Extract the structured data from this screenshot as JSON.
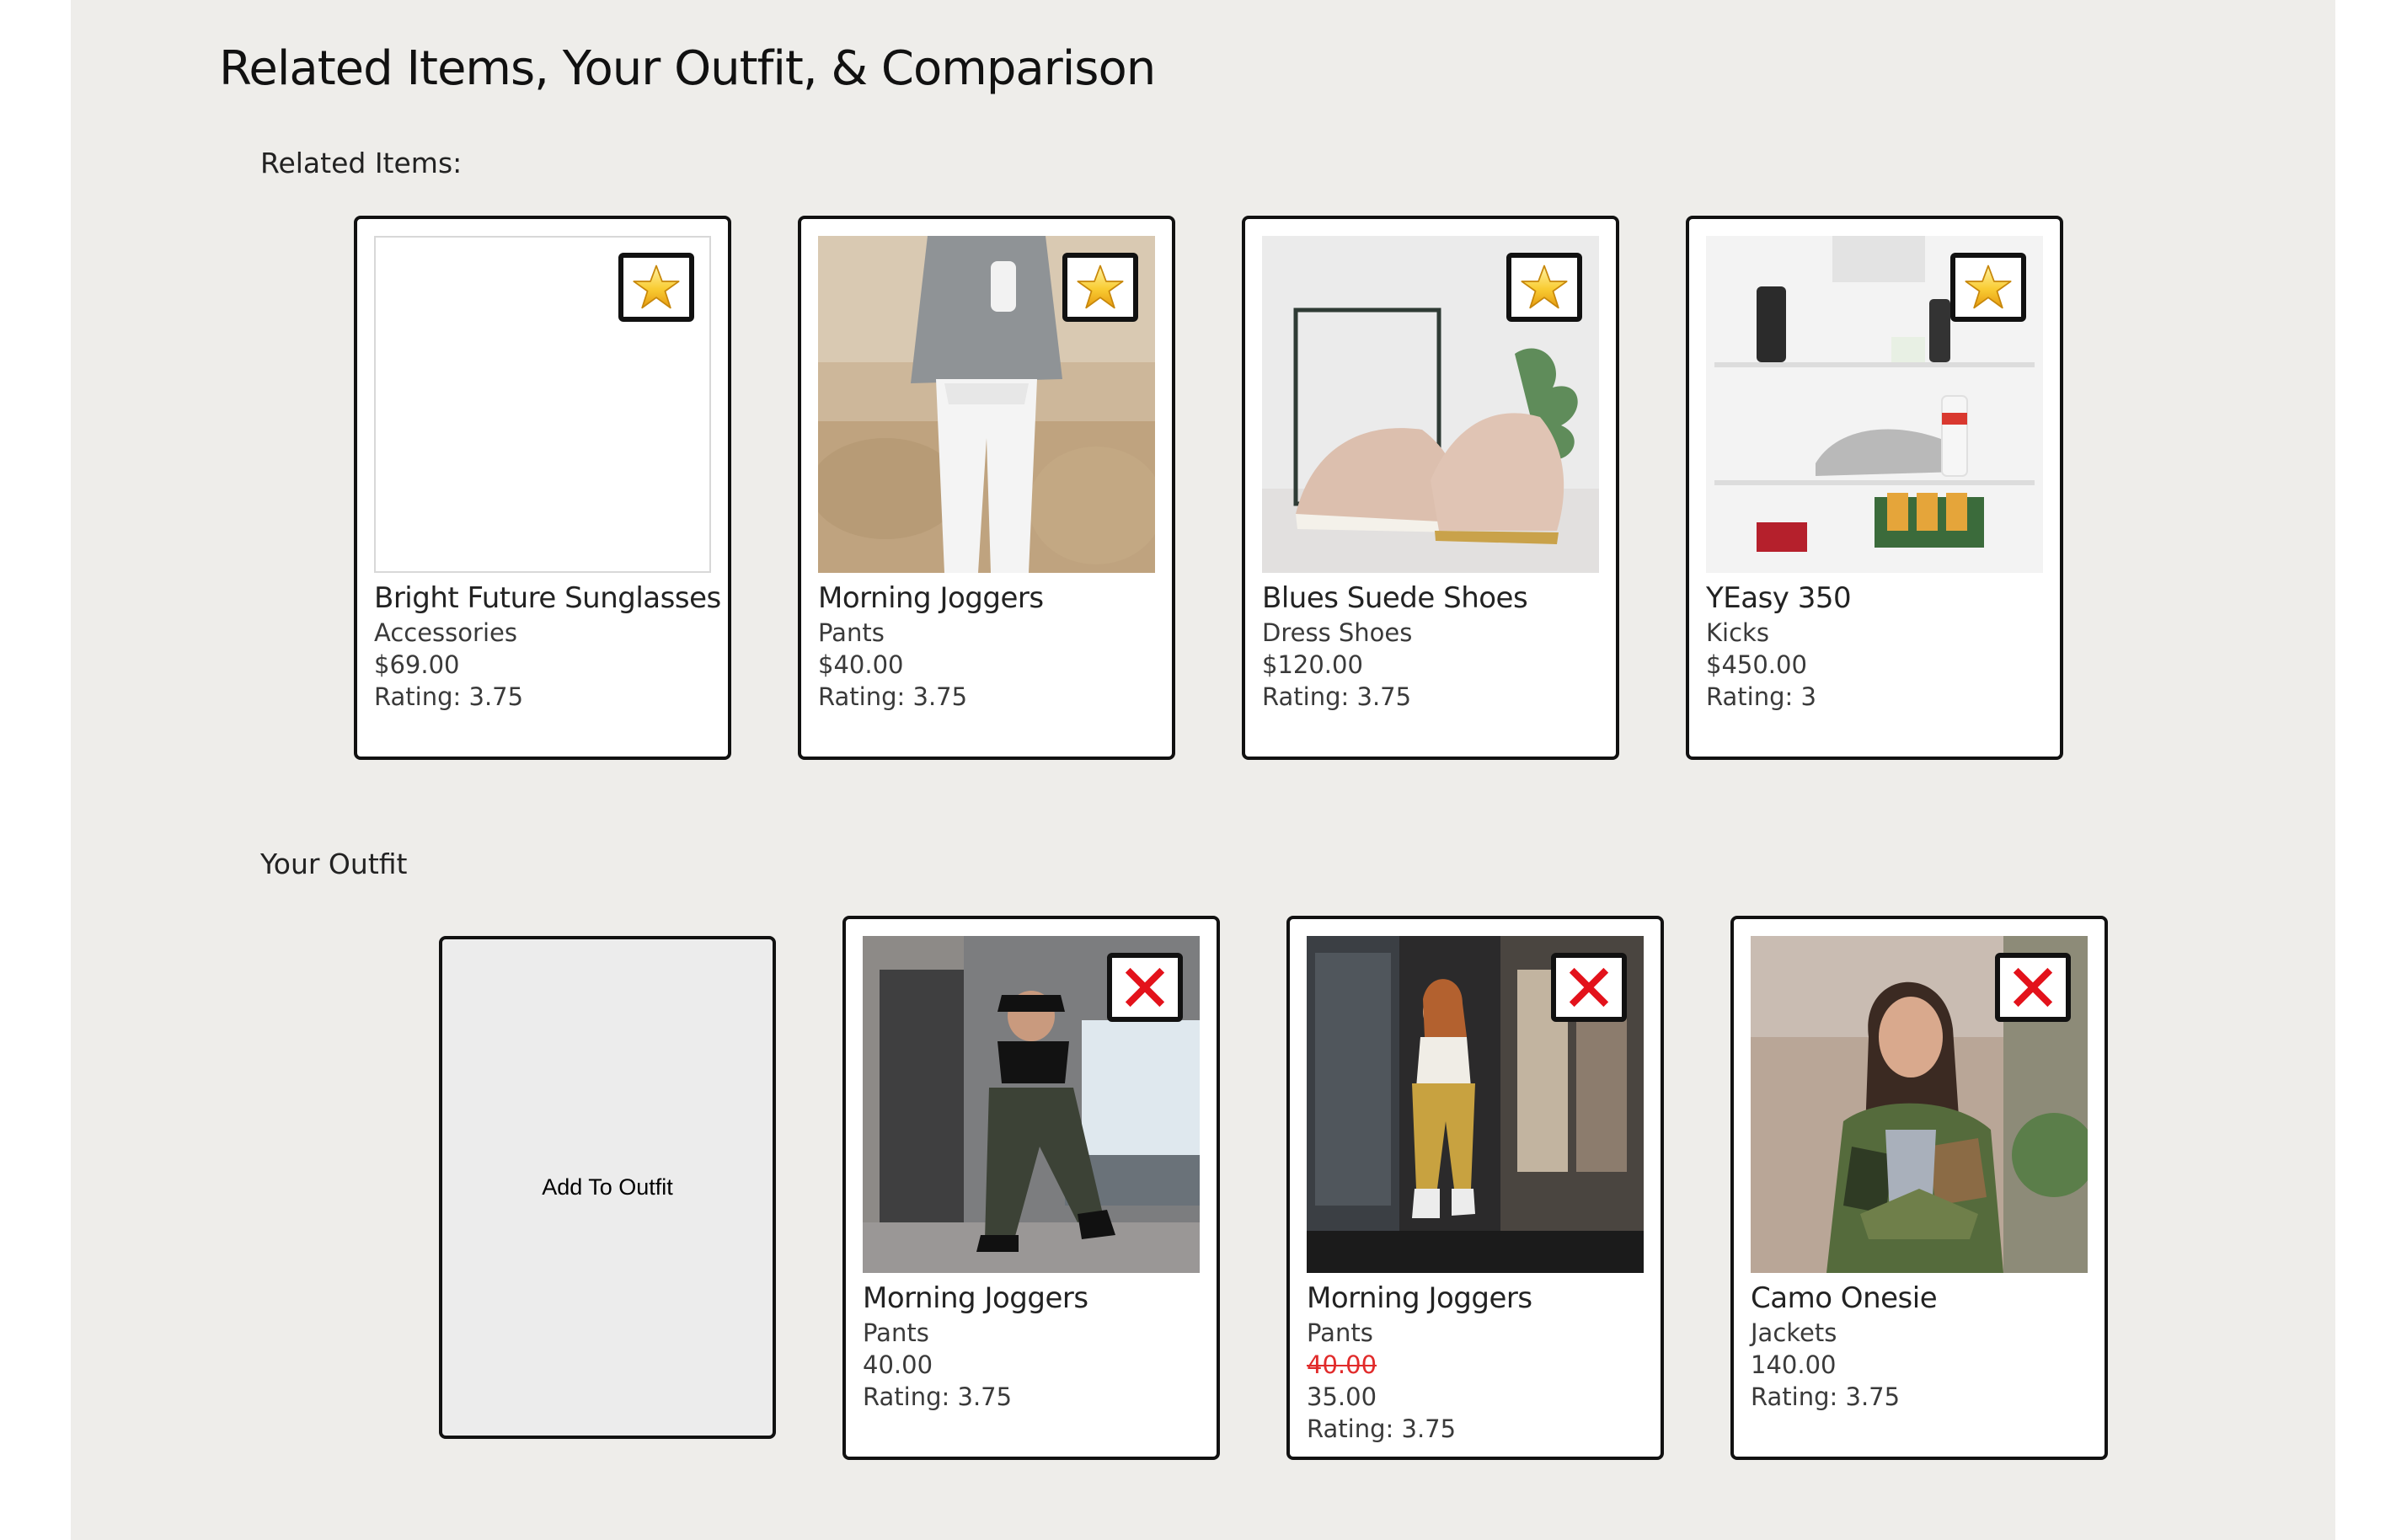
{
  "page": {
    "title": "Related Items, Your Outfit, & Comparison"
  },
  "related": {
    "label": "Related Items:",
    "items": [
      {
        "name": "Bright Future Sunglasses",
        "category": "Accessories",
        "price": "$69.00",
        "rating": "Rating: 3.75",
        "icon": "star-icon"
      },
      {
        "name": "Morning Joggers",
        "category": "Pants",
        "price": "$40.00",
        "rating": "Rating: 3.75",
        "icon": "star-icon"
      },
      {
        "name": "Blues Suede Shoes",
        "category": "Dress Shoes",
        "price": "$120.00",
        "rating": "Rating: 3.75",
        "icon": "star-icon"
      },
      {
        "name": "YEasy 350",
        "category": "Kicks",
        "price": "$450.00",
        "rating": "Rating: 3",
        "icon": "star-icon"
      }
    ]
  },
  "outfit": {
    "label": "Your Outfit",
    "add_label": "Add To Outfit",
    "items": [
      {
        "name": "Morning Joggers",
        "category": "Pants",
        "price": "40.00",
        "rating": "Rating: 3.75",
        "icon": "close-icon"
      },
      {
        "name": "Morning Joggers",
        "category": "Pants",
        "original_price": "40.00",
        "sale_price": "35.00",
        "rating": "Rating: 3.75",
        "icon": "close-icon"
      },
      {
        "name": "Camo Onesie",
        "category": "Jackets",
        "price": "140.00",
        "rating": "Rating: 3.75",
        "icon": "close-icon"
      }
    ]
  },
  "colors": {
    "panel_background": "#eeedea",
    "card_border": "#111111",
    "star_fill": "#f6c22b",
    "remove_x": "#e3121b",
    "sale_strike": "#e12b2b"
  }
}
